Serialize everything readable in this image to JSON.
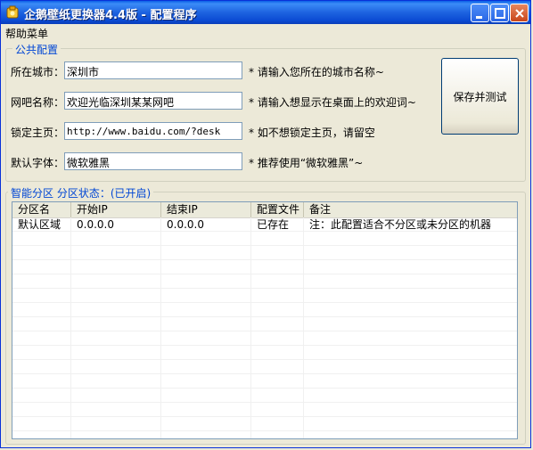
{
  "window": {
    "title": "企鹅壁纸更换器4.4版 - 配置程序"
  },
  "menu": {
    "help": "帮助菜单"
  },
  "public_config": {
    "legend": "公共配置",
    "fields": [
      {
        "label": "所在城市：",
        "value": "深圳市",
        "hint": "* 请输入您所在的城市名称~"
      },
      {
        "label": "网吧名称：",
        "value": "欢迎光临深圳某某网吧",
        "hint": "* 请输入想显示在桌面上的欢迎词~"
      },
      {
        "label": "锁定主页：",
        "value": "http://www.baidu.com/?desk",
        "hint": "* 如不想锁定主页，请留空"
      },
      {
        "label": "默认字体：",
        "value": "微软雅黑",
        "hint": "* 推荐使用“微软雅黑”~"
      }
    ],
    "save_button": "保存并测试"
  },
  "partition": {
    "legend": "智能分区 分区状态：(已开启)",
    "columns": [
      "分区名",
      "开始IP",
      "结束IP",
      "配置文件",
      "备注"
    ],
    "rows": [
      [
        "默认区域",
        "0.0.0.0",
        "0.0.0.0",
        "已存在",
        "注：此配置适合不分区或未分区的机器"
      ]
    ]
  },
  "colors": {
    "titlebar": "#0a5fe6",
    "legend": "#0046d5",
    "background": "#ece9d8"
  }
}
